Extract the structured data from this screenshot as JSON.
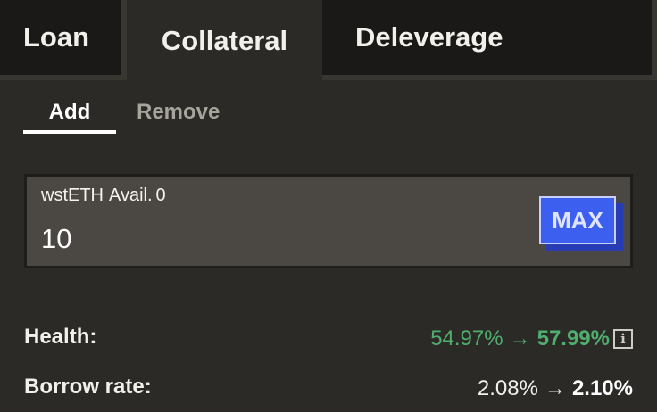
{
  "tabs": {
    "loan": "Loan",
    "collateral": "Collateral",
    "deleverage": "Deleverage"
  },
  "subtabs": {
    "add": "Add",
    "remove": "Remove"
  },
  "input": {
    "token": "wstETH",
    "avail_label": "Avail.",
    "avail_value": "0",
    "value": "10",
    "max_label": "MAX"
  },
  "stats": {
    "health": {
      "label": "Health:",
      "current": "54.97%",
      "arrow": "→",
      "new": "57.99%",
      "info_icon": "i"
    },
    "borrow_rate": {
      "label": "Borrow rate:",
      "current": "2.08%",
      "arrow": "→",
      "new": "2.10%"
    }
  },
  "colors": {
    "accent": "#3d5ff0",
    "health_green": "#4fae6d",
    "panel_bg": "#2b2a26",
    "input_bg": "#4b4843"
  }
}
